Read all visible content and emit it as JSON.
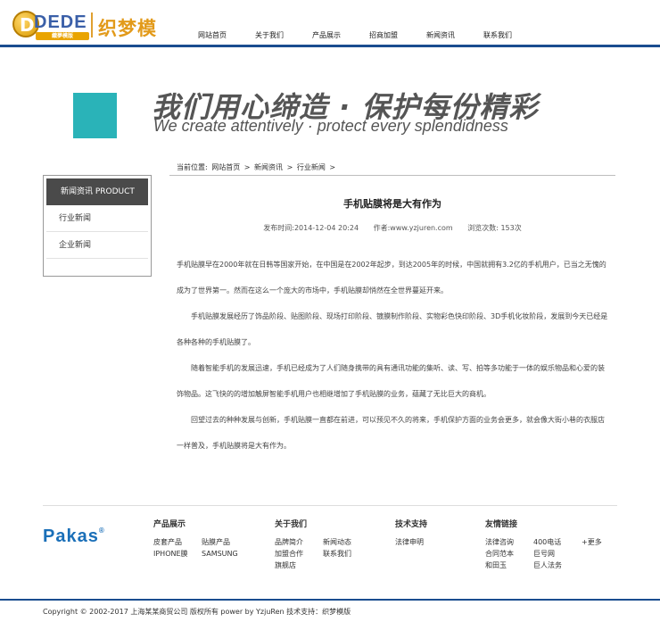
{
  "header": {
    "logo_en": "DEDE",
    "logo_sub": "織夢模版",
    "logo_cn": "织梦模",
    "nav": [
      "网站首页",
      "关于我们",
      "产品展示",
      "招商加盟",
      "新闻资讯",
      "联系我们"
    ]
  },
  "banner": {
    "cn": "我们用心缔造 · 保护每份精彩",
    "en": "We create attentively  ·  protect every splendidness"
  },
  "breadcrumb": {
    "prefix": "当前位置:",
    "items": [
      "网站首页",
      ">",
      "新闻资讯",
      ">",
      "行业新闻",
      ">"
    ]
  },
  "sidebar": {
    "header": "新闻资讯  PRODUCT",
    "items": [
      "行业新闻",
      "企业新闻"
    ]
  },
  "article": {
    "title": "手机贴膜将是大有作为",
    "published": "发布时间:2014-12-04 20:24",
    "author": "作者:www.yzjuren.com",
    "views": "浏览次数: 153次",
    "paragraphs": [
      "手机贴膜早在2000年就在日韩等国家开始，在中国是在2002年起步，到达2005年的时候，中国就拥有3.2亿的手机用户，已当之无愧的成为了世界第一。然而在这么一个庞大的市场中，手机贴膜却悄然在全世界蔓延开来。",
      "手机贴膜发展经历了饰品阶段、贴图阶段、现场打印阶段、镀膜制作阶段、实物彩色快印阶段、3D手机化妆阶段，发展到今天已经是各种各种的手机贴膜了。",
      "随着智能手机的发展迅速，手机已经成为了人们随身携带的具有通讯功能的集听、读、写、拍等多功能于一体的娱乐物品和心爱的装饰物品。这飞快的的增加触屏智能手机用户也相继增加了手机贴膜的业务，蕴藏了无比巨大的商机。",
      "回望过去的种种发展与创新，手机贴膜一直都在前进，可以预见不久的将来，手机保护方面的业务会更多，就会像大街小巷的衣服店一样普及，手机贴膜将是大有作为。"
    ]
  },
  "footer": {
    "brand": "Pakas",
    "brand_mark": "®",
    "cols": [
      {
        "title": "产品展示",
        "rows": [
          [
            "皮套产品",
            "贴膜产品"
          ],
          [
            "IPHONE膜",
            "SAMSUNG"
          ]
        ]
      },
      {
        "title": "关于我们",
        "rows": [
          [
            "品牌简介",
            "新闻动态"
          ],
          [
            "加盟合作",
            "联系我们"
          ],
          [
            "旗舰店",
            ""
          ]
        ]
      },
      {
        "title": "技术支持",
        "rows": [
          [
            "法律申明",
            ""
          ]
        ]
      },
      {
        "title": "友情链接",
        "rows": [
          [
            "法律咨询",
            "400电话",
            "+更多"
          ],
          [
            "合同范本",
            "巨号网",
            ""
          ],
          [
            "和田玉",
            "巨人法务",
            ""
          ]
        ]
      }
    ],
    "copyright": "Copyright © 2002-2017 上海某某商贸公司 版权所有 power by YzjuRen  技术支持：织梦模版"
  },
  "colors": {
    "accent_blue": "#1a4d8f",
    "banner_teal": "#2ab3b8",
    "logo_orange": "#e29a1a",
    "brand_blue": "#1a6fb8"
  }
}
